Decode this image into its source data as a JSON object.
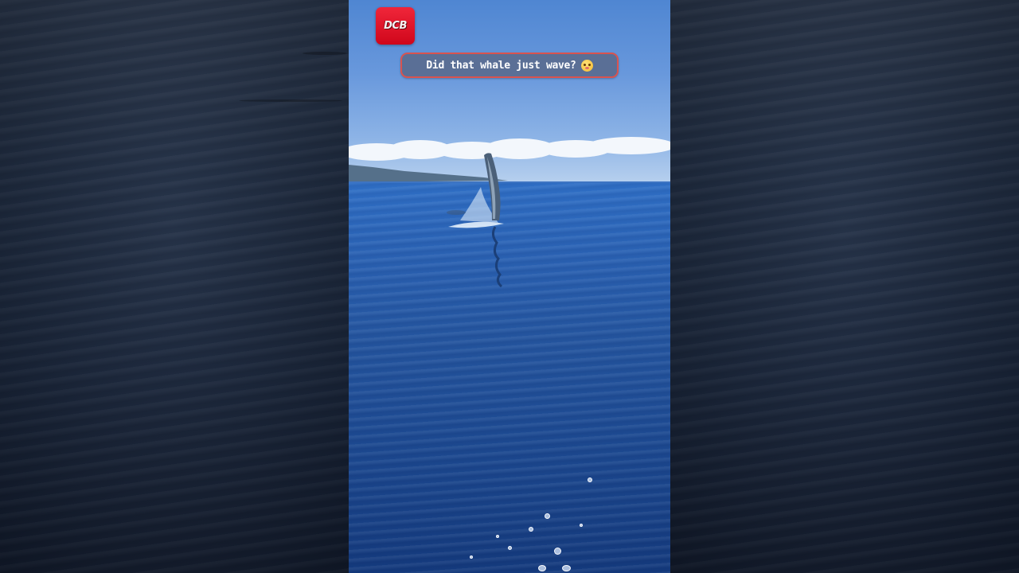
{
  "brand": {
    "logo_text": "DCB"
  },
  "caption": {
    "text": "Did that whale just wave?",
    "emoji": "flushed-face-emoji"
  },
  "colors": {
    "logo_red": "#e0142a",
    "caption_bg": "#5a6f96",
    "caption_border": "#d9534f",
    "sky": "#6898dc",
    "sea": "#24559f"
  }
}
